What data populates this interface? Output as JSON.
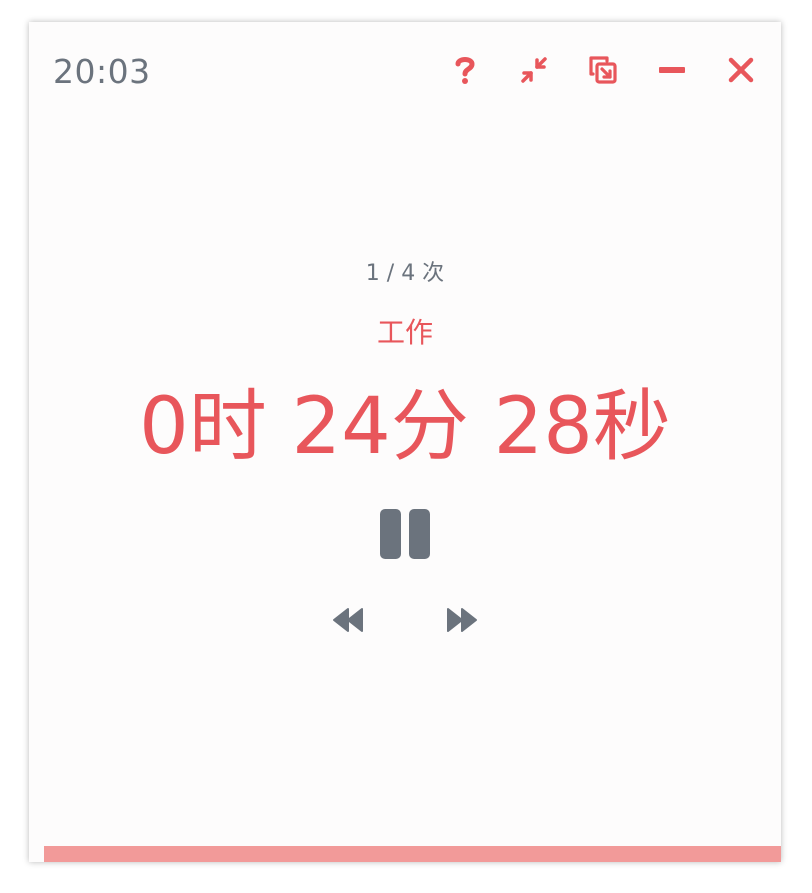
{
  "header": {
    "clock": "20:03",
    "actions": [
      {
        "name": "help",
        "icon": "question-mark-icon"
      },
      {
        "name": "compact",
        "icon": "compress-arrows-icon"
      },
      {
        "name": "mini-window",
        "icon": "window-restore-icon"
      },
      {
        "name": "minimize",
        "icon": "minus-icon"
      },
      {
        "name": "close",
        "icon": "close-x-icon"
      }
    ]
  },
  "session": {
    "count_label": "1 / 4 次",
    "mode_label": "工作",
    "remaining": "0时 24分 28秒"
  },
  "controls": {
    "pause_icon": "pause-icon",
    "previous_icon": "fast-backward-icon",
    "next_icon": "fast-forward-icon"
  },
  "progress": {
    "fraction": 1.0
  },
  "colors": {
    "accent": "#e8565b",
    "muted": "#6b737d",
    "progress_fill": "#f29a99",
    "background": "#fdfcfc"
  }
}
